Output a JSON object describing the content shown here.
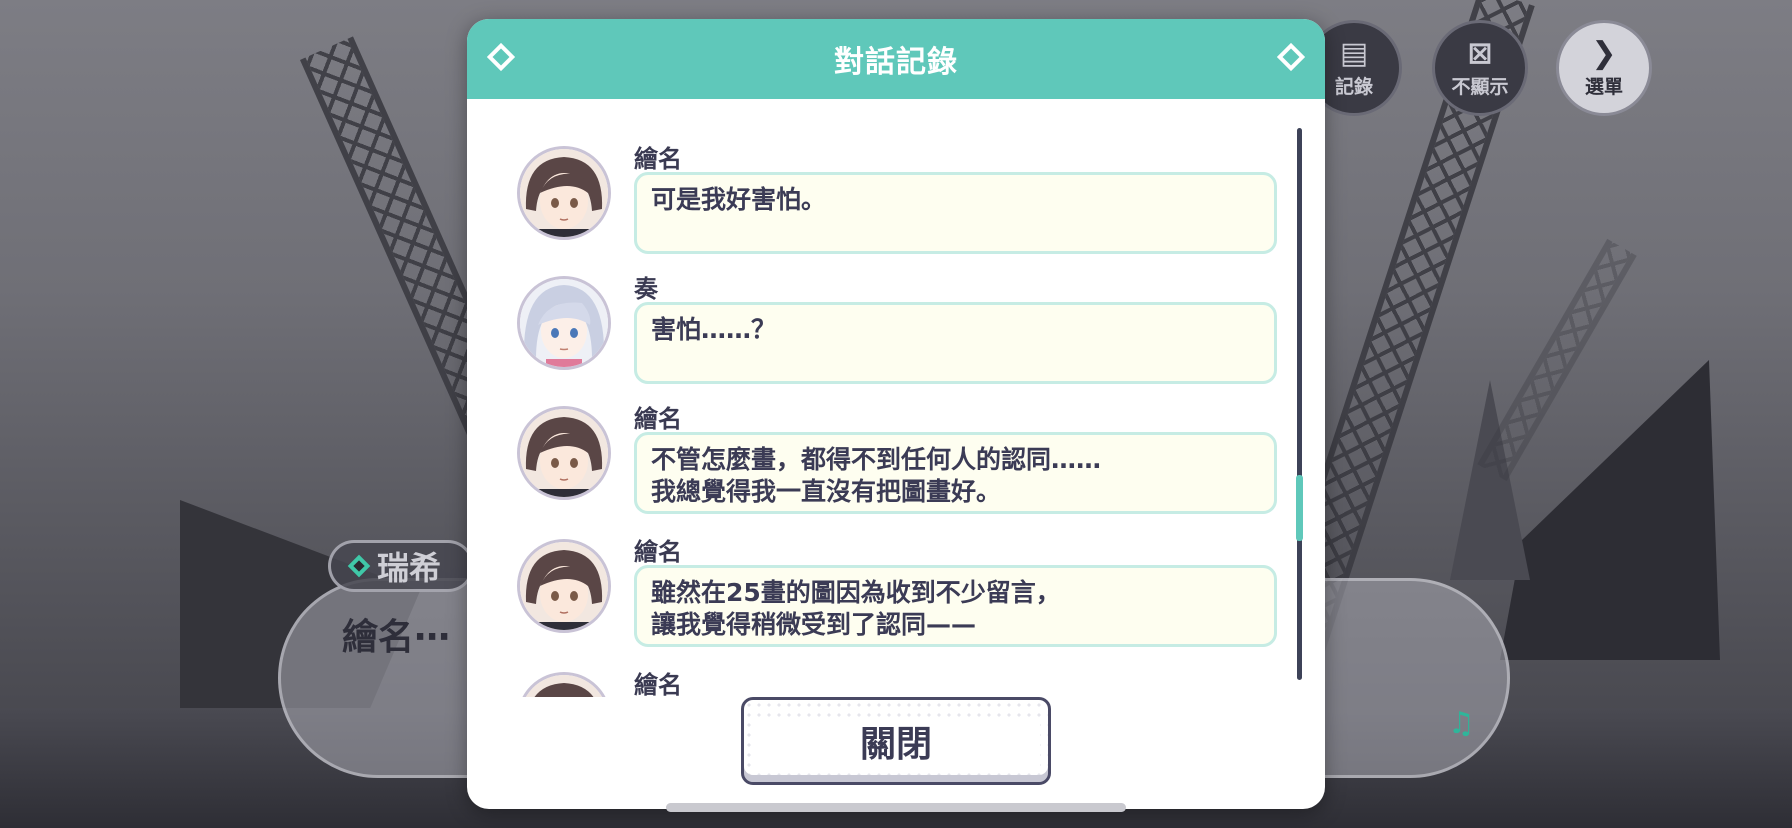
{
  "modal": {
    "title": "對話記錄",
    "close_label": "關閉",
    "entries": [
      {
        "speaker": "繪名",
        "avatar": "ena-icon",
        "text": "可是我好害怕。"
      },
      {
        "speaker": "奏",
        "avatar": "kanade-icon",
        "text": "害怕……？"
      },
      {
        "speaker": "繪名",
        "avatar": "ena-icon",
        "text": "不管怎麼畫，都得不到任何人的認同……\n我總覺得我一直沒有把圖畫好。"
      },
      {
        "speaker": "繪名",
        "avatar": "ena-icon",
        "text": "雖然在25畫的圖因為收到不少留言，\n讓我覺得稍微受到了認同——"
      },
      {
        "speaker": "繪名",
        "avatar": "ena-icon",
        "text": ""
      }
    ]
  },
  "game_buttons": {
    "log_label": "記錄",
    "hide_label": "不顯示",
    "menu_label": "選單"
  },
  "dialogue": {
    "speaker": "瑞希",
    "text": "繪名⋯"
  },
  "colors": {
    "accent": "#5fc8ba",
    "bubble_bg": "#fefef0",
    "bubble_border": "#c6ece4",
    "text": "#3b3b55"
  }
}
